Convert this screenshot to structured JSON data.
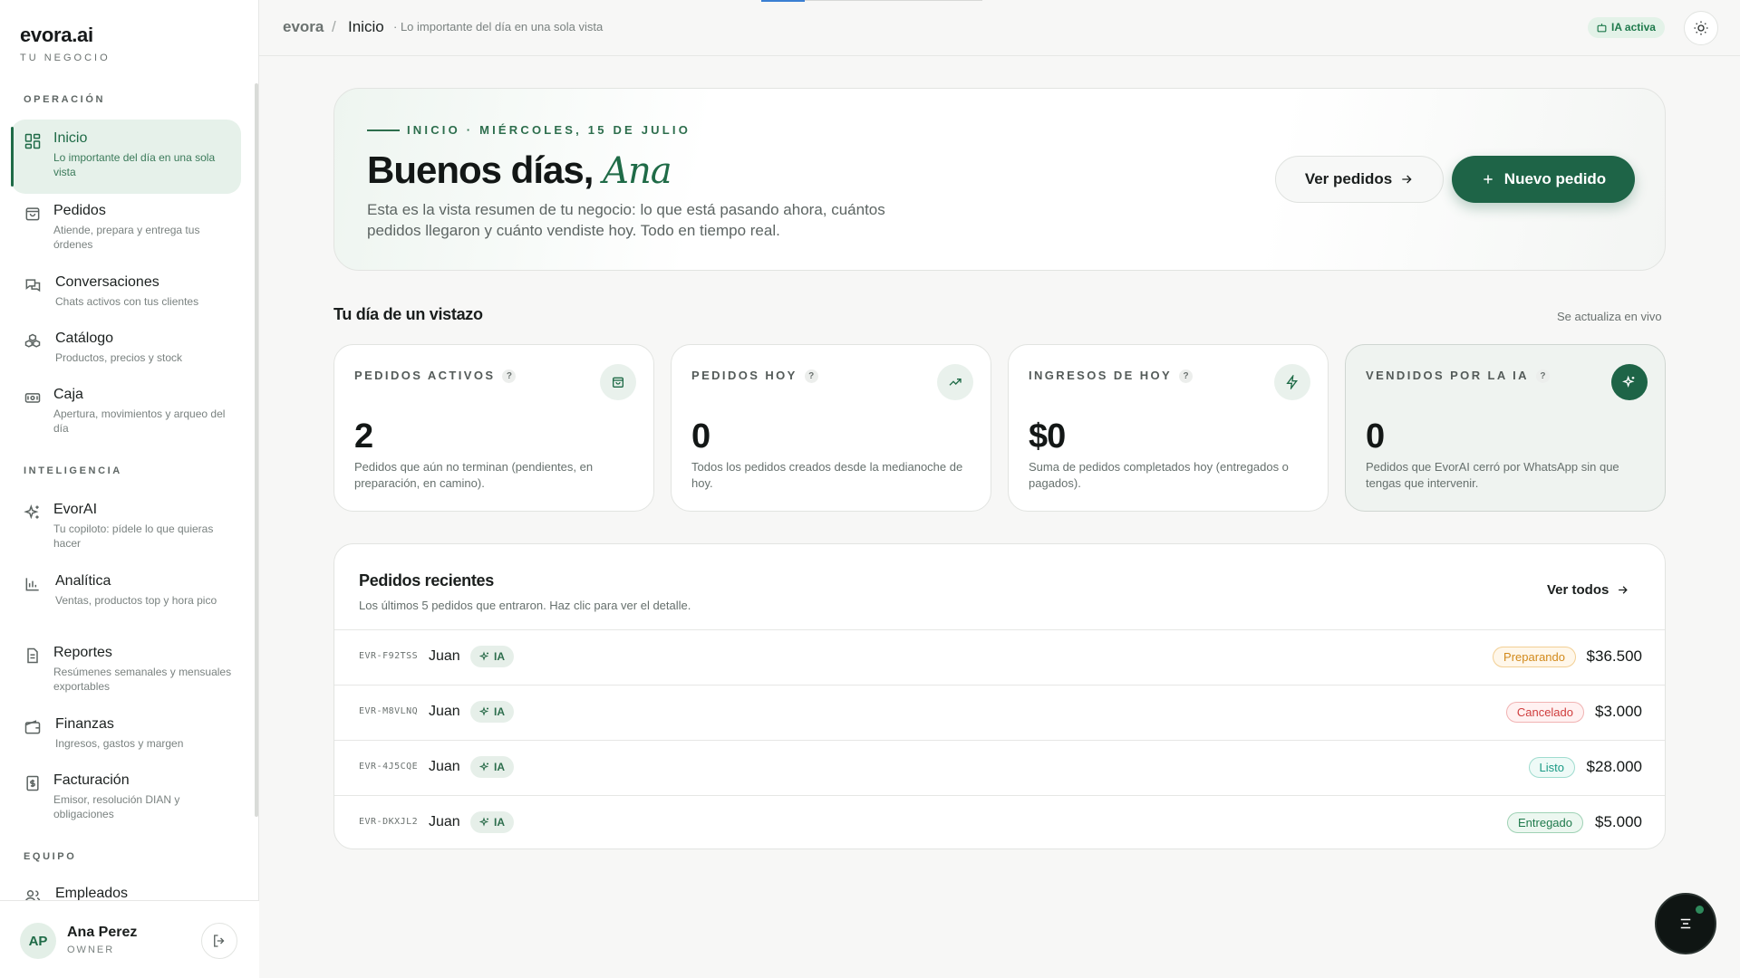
{
  "sidebar": {
    "brand": "evora.ai",
    "brand_sub": "TU NEGOCIO",
    "sections": {
      "operacion": "OPERACIÓN",
      "inteligencia": "INTELIGENCIA",
      "equipo": "EQUIPO"
    },
    "items": [
      {
        "title": "Inicio",
        "desc": "Lo importante del día en una sola vista",
        "icon": "dashboard-icon",
        "active": true
      },
      {
        "title": "Pedidos",
        "desc": "Atiende, prepara y entrega tus órdenes",
        "icon": "shopping-bag-icon"
      },
      {
        "title": "Conversaciones",
        "desc": "Chats activos con tus clientes",
        "icon": "chat-icon"
      },
      {
        "title": "Catálogo",
        "desc": "Productos, precios y stock",
        "icon": "boxes-icon"
      },
      {
        "title": "Caja",
        "desc": "Apertura, movimientos y arqueo del día",
        "icon": "cash-register-icon"
      },
      {
        "title": "EvorAI",
        "desc": "Tu copiloto: pídele lo que quieras hacer",
        "icon": "sparkles-icon"
      },
      {
        "title": "Analítica",
        "desc": "Ventas, productos top y hora pico",
        "icon": "bar-chart-icon"
      },
      {
        "title": "Reportes",
        "desc": "Resúmenes semanales y mensuales exportables",
        "icon": "document-icon"
      },
      {
        "title": "Finanzas",
        "desc": "Ingresos, gastos y margen",
        "icon": "wallet-icon"
      },
      {
        "title": "Facturación",
        "desc": "Emisor, resolución DIAN y obligaciones",
        "icon": "invoice-icon"
      },
      {
        "title": "Empleados",
        "desc": "",
        "icon": "users-icon"
      }
    ],
    "user": {
      "initials": "AP",
      "name": "Ana Perez",
      "role": "OWNER"
    }
  },
  "topbar": {
    "brand": "evora",
    "separator": "/",
    "page": "Inicio",
    "desc": "· Lo importante del día en una sola vista",
    "ia_status": "IA activa"
  },
  "hero": {
    "kicker": "INICIO · MIÉRCOLES, 15 DE JULIO",
    "greeting": "Buenos días,",
    "name": "Ana",
    "text": "Esta es la vista resumen de tu negocio: lo que está pasando ahora, cuántos pedidos llegaron y cuánto vendiste hoy. Todo en tiempo real.",
    "btn_orders": "Ver pedidos",
    "btn_new": "Nuevo pedido"
  },
  "overview": {
    "title": "Tu día de un vistazo",
    "live": "Se actualiza en vivo",
    "help": "?",
    "cards": [
      {
        "label": "PEDIDOS ACTIVOS",
        "value": "2",
        "desc": "Pedidos que aún no terminan (pendientes, en preparación, en camino).",
        "icon": "shopping-bag-icon"
      },
      {
        "label": "PEDIDOS HOY",
        "value": "0",
        "desc": "Todos los pedidos creados desde la medianoche de hoy.",
        "icon": "trending-up-icon"
      },
      {
        "label": "INGRESOS DE HOY",
        "value": "$0",
        "desc": "Suma de pedidos completados hoy (entregados o pagados).",
        "icon": "lightning-icon"
      },
      {
        "label": "VENDIDOS POR LA IA",
        "value": "0",
        "desc": "Pedidos que EvorAI cerró por WhatsApp sin que tengas que intervenir.",
        "icon": "sparkles-icon"
      }
    ]
  },
  "orders": {
    "title": "Pedidos recientes",
    "subtitle": "Los últimos 5 pedidos que entraron. Haz clic para ver el detalle.",
    "see_all": "Ver todos",
    "ia_tag": "IA",
    "rows": [
      {
        "code": "EVR-F92TSS",
        "name": "Juan",
        "status": "Preparando",
        "status_key": "preparando",
        "amount": "$36.500"
      },
      {
        "code": "EVR-M8VLNQ",
        "name": "Juan",
        "status": "Cancelado",
        "status_key": "cancelado",
        "amount": "$3.000"
      },
      {
        "code": "EVR-4J5CQE",
        "name": "Juan",
        "status": "Listo",
        "status_key": "listo",
        "amount": "$28.000"
      },
      {
        "code": "EVR-DKXJL2",
        "name": "Juan",
        "status": "Entregado",
        "status_key": "entregado",
        "amount": "$5.000"
      }
    ]
  },
  "colors": {
    "accent": "#1e6447",
    "accent_light": "#e6f1ea",
    "status_preparando": "#d28a1c",
    "status_cancelado": "#cf3d3d",
    "status_listo": "#1a9a85",
    "status_entregado": "#1f7a4c"
  }
}
